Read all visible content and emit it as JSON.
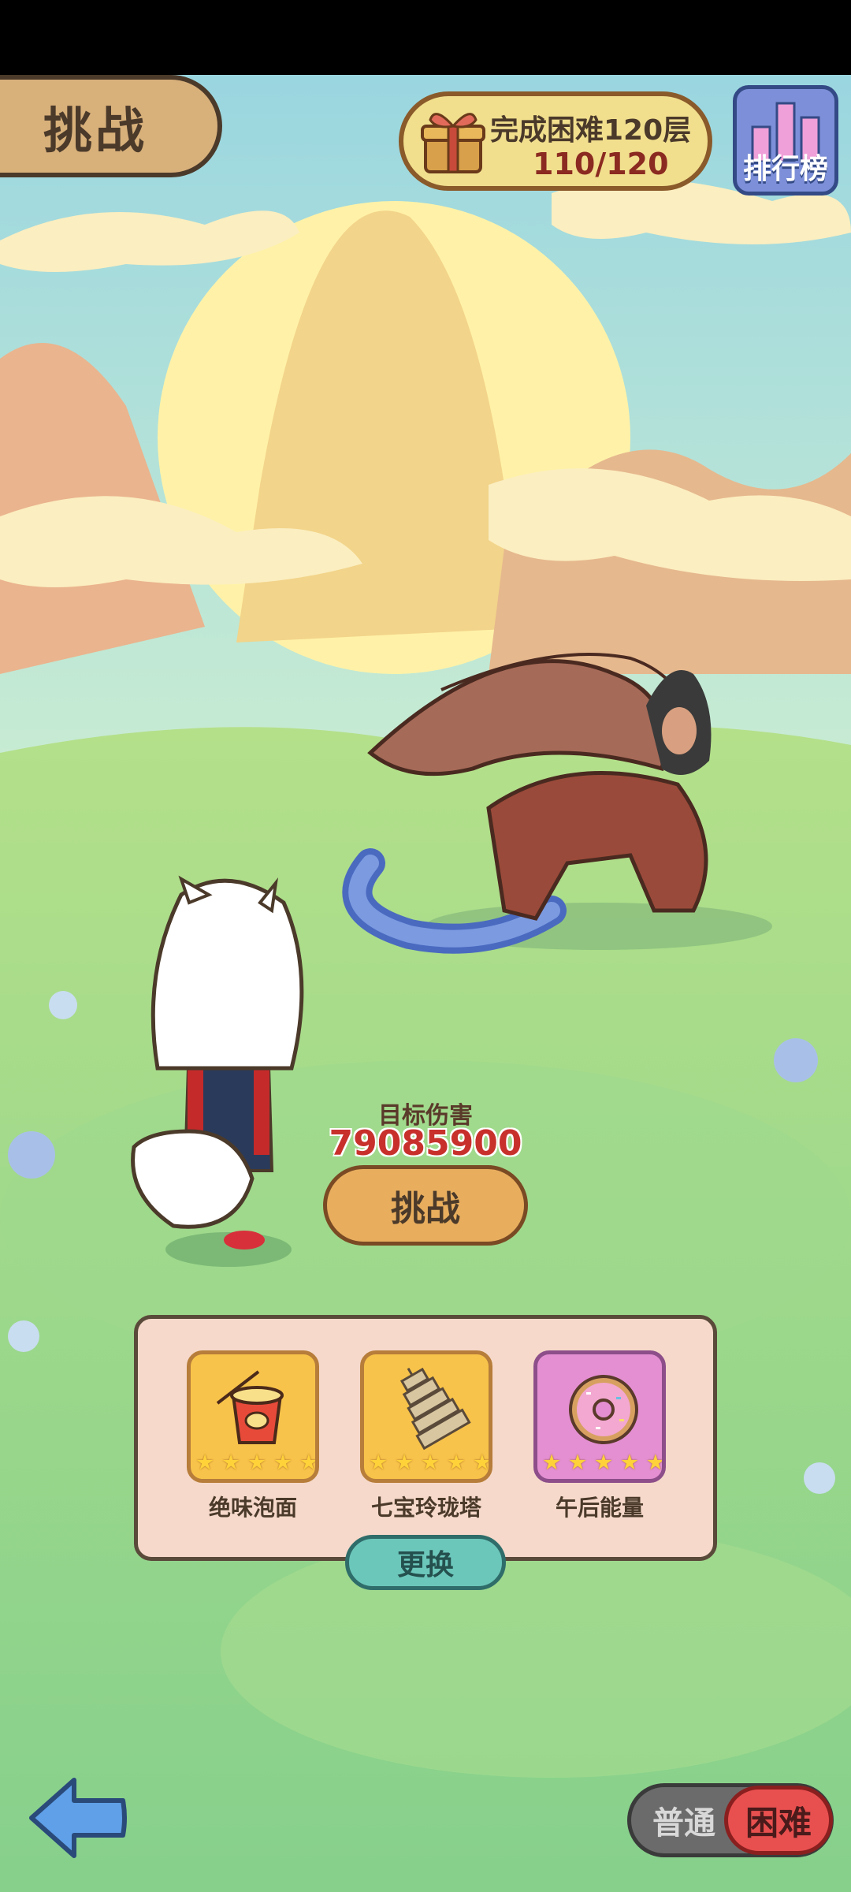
{
  "header": {
    "title": "挑战",
    "task": {
      "title": "完成困难120层",
      "progress": "110/120",
      "icon": "gift-icon"
    },
    "ranking_label": "排行榜"
  },
  "battle": {
    "target_damage_label": "目标伤害",
    "target_damage_value": "79085900",
    "challenge_button": "挑战"
  },
  "items": [
    {
      "name": "绝味泡面",
      "icon": "instant-noodles-icon",
      "stars": 5
    },
    {
      "name": "七宝玲珑塔",
      "icon": "pagoda-icon",
      "stars": 5
    },
    {
      "name": "午后能量",
      "icon": "donut-icon",
      "stars": 5
    }
  ],
  "swap_button": "更换",
  "mode_toggle": {
    "normal": "普通",
    "hard": "困难",
    "selected": "hard"
  },
  "colors": {
    "accent": "#e8ae5e",
    "hard": "#e8504f",
    "teal": "#6cc7bb"
  }
}
